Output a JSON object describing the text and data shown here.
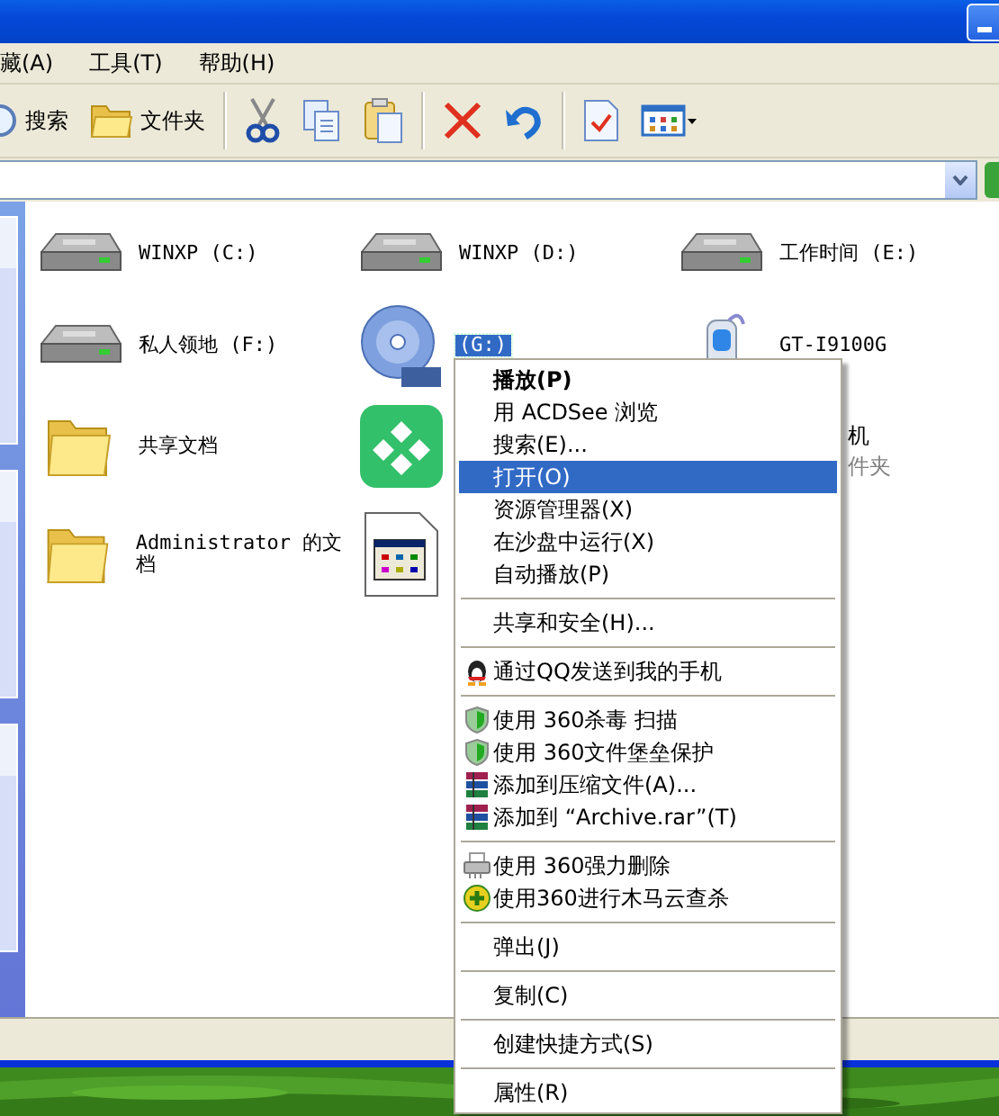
{
  "menu_bar": [
    "藏(A)",
    "工具(T)",
    "帮助(H)"
  ],
  "toolbar": [
    {
      "kind": "search",
      "label": "搜索"
    },
    {
      "kind": "folders",
      "label": "文件夹"
    },
    {
      "kind": "sep"
    },
    {
      "kind": "cut"
    },
    {
      "kind": "copy"
    },
    {
      "kind": "paste"
    },
    {
      "kind": "sep"
    },
    {
      "kind": "delete"
    },
    {
      "kind": "undo"
    },
    {
      "kind": "sep"
    },
    {
      "kind": "properties"
    },
    {
      "kind": "views"
    }
  ],
  "items": [
    {
      "kind": "drive",
      "label": "WINXP (C:)",
      "selected": false
    },
    {
      "kind": "drive",
      "label": "WINXP (D:)",
      "selected": false
    },
    {
      "kind": "drive",
      "label": "工作时间 (E:)",
      "selected": false
    },
    {
      "kind": "drive",
      "label": "私人领地 (F:)",
      "selected": false
    },
    {
      "kind": "dvd",
      "label": "(G:)",
      "selected": true
    },
    {
      "kind": "phone",
      "label": "GT-I9100G",
      "selected": false
    },
    {
      "kind": "folder",
      "label": "共享文档",
      "selected": false
    },
    {
      "kind": "app"
    },
    {
      "kind": "hidden",
      "label": "机",
      "sublabel": "件夹"
    },
    {
      "kind": "folder",
      "label": "Administrator 的文档",
      "selected": false
    },
    {
      "kind": "file"
    }
  ],
  "context_menu": [
    {
      "kind": "item",
      "label": "播放(P)",
      "bold": true,
      "selected": false
    },
    {
      "kind": "item",
      "label": "用 ACDSee 浏览",
      "bold": false,
      "selected": false
    },
    {
      "kind": "item",
      "label": "搜索(E)...",
      "bold": false,
      "selected": false
    },
    {
      "kind": "item",
      "label": "打开(O)",
      "bold": false,
      "selected": true
    },
    {
      "kind": "item",
      "label": "资源管理器(X)",
      "bold": false,
      "selected": false
    },
    {
      "kind": "item",
      "label": "在沙盘中运行(X)",
      "bold": false,
      "selected": false
    },
    {
      "kind": "item",
      "label": "自动播放(P)",
      "bold": false,
      "selected": false
    },
    {
      "kind": "separator"
    },
    {
      "kind": "item",
      "label": "共享和安全(H)...",
      "bold": false,
      "selected": false
    },
    {
      "kind": "separator"
    },
    {
      "kind": "penguin",
      "label": "通过QQ发送到我的手机",
      "bold": false,
      "selected": false
    },
    {
      "kind": "separator"
    },
    {
      "kind": "shield",
      "label": "使用 360杀毒 扫描",
      "bold": false,
      "selected": false
    },
    {
      "kind": "shield",
      "label": "使用 360文件堡垒保护",
      "bold": false,
      "selected": false
    },
    {
      "kind": "books",
      "label": "添加到压缩文件(A)...",
      "bold": false,
      "selected": false
    },
    {
      "kind": "books",
      "label": "添加到 “Archive.rar”(T)",
      "bold": false,
      "selected": false
    },
    {
      "kind": "separator"
    },
    {
      "kind": "shredder",
      "label": "使用 360强力删除",
      "bold": false,
      "selected": false
    },
    {
      "kind": "plus",
      "label": "使用360进行木马云查杀",
      "bold": false,
      "selected": false
    },
    {
      "kind": "separator"
    },
    {
      "kind": "item",
      "label": "弹出(J)",
      "bold": false,
      "selected": false
    },
    {
      "kind": "separator"
    },
    {
      "kind": "item",
      "label": "复制(C)",
      "bold": false,
      "selected": false
    },
    {
      "kind": "separator"
    },
    {
      "kind": "item",
      "label": "创建快捷方式(S)",
      "bold": false,
      "selected": false
    },
    {
      "kind": "separator"
    },
    {
      "kind": "item",
      "label": "属性(R)",
      "bold": false,
      "selected": false
    }
  ]
}
